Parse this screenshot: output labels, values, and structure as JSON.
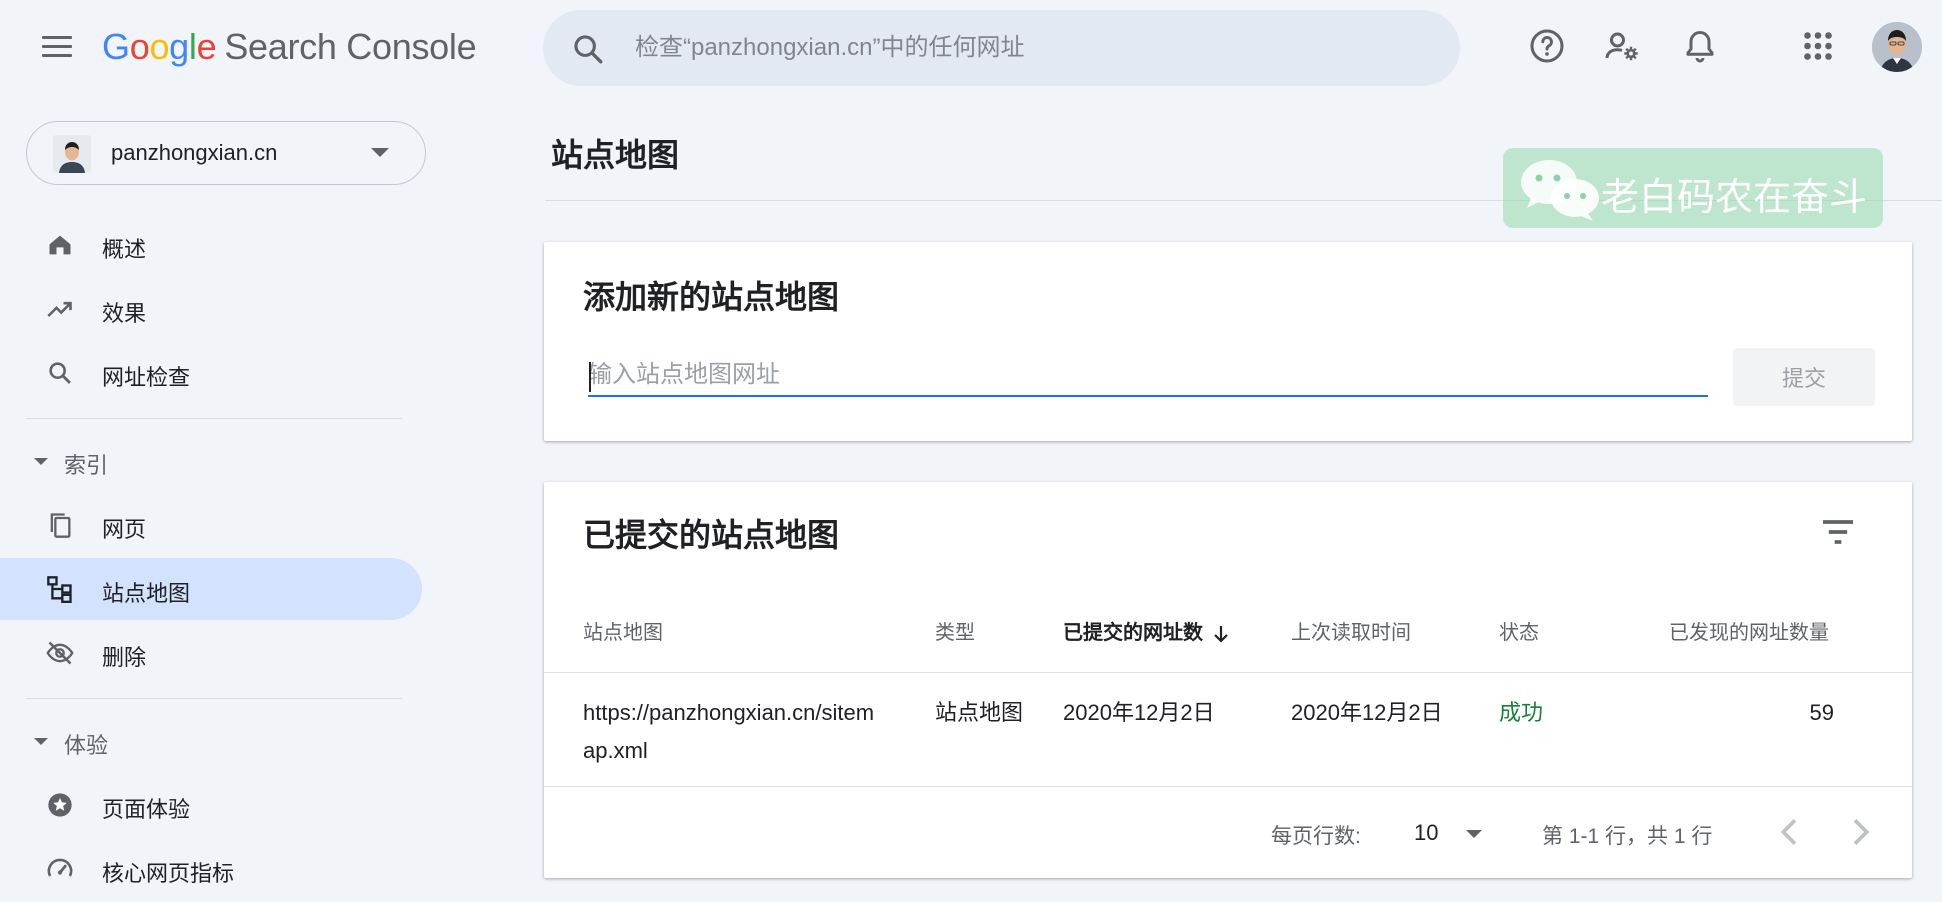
{
  "header": {
    "logo_parts": [
      "G",
      "o",
      "o",
      "g",
      "l",
      "e"
    ],
    "product_name": "Search Console",
    "search_placeholder": "检查“panzhongxian.cn”中的任何网址"
  },
  "icons": {
    "menu": "menu-icon",
    "search": "search-icon",
    "help": "help-icon",
    "settings_user": "manage-users-icon",
    "notifications": "bell-icon",
    "apps": "apps-grid-icon",
    "account": "account-avatar"
  },
  "sidebar": {
    "property": "panzhongxian.cn",
    "items_top": [
      {
        "label": "概述",
        "icon": "home-icon"
      },
      {
        "label": "效果",
        "icon": "trending-up-icon"
      },
      {
        "label": "网址检查",
        "icon": "search-icon"
      }
    ],
    "section_index": "索引",
    "items_index": [
      {
        "label": "网页",
        "icon": "pages-icon"
      },
      {
        "label": "站点地图",
        "icon": "sitemap-icon",
        "active": true
      },
      {
        "label": "删除",
        "icon": "eye-off-icon"
      }
    ],
    "section_experience": "体验",
    "items_experience": [
      {
        "label": "页面体验",
        "icon": "page-experience-icon"
      },
      {
        "label": "核心网页指标",
        "icon": "speedometer-icon"
      }
    ]
  },
  "main": {
    "page_title": "站点地图",
    "watermark_text": "老白码农在奋斗",
    "add_card": {
      "title": "添加新的站点地图",
      "input_placeholder": "输入站点地图网址",
      "submit_label": "提交"
    },
    "list_card": {
      "title": "已提交的站点地图",
      "columns": [
        "站点地图",
        "类型",
        "已提交的网址数",
        "上次读取时间",
        "状态",
        "已发现的网址数量"
      ],
      "sorted_column": "已提交的网址数",
      "rows": [
        {
          "sitemap_line1": "https://panzhongxian.cn/sitem",
          "sitemap_line2": "ap.xml",
          "type": "站点地图",
          "submitted": "2020年12月2日",
          "last_read": "2020年12月2日",
          "status": "成功",
          "discovered": "59"
        }
      ],
      "pager": {
        "rows_per_page_label": "每页行数:",
        "rows_per_page": "10",
        "range_text": "第 1-1 行，共 1 行"
      }
    }
  },
  "colors": {
    "accent": "#1a73e8",
    "active_nav": "#d3e3fd",
    "success": "#188038",
    "background": "#f1f4f9"
  }
}
